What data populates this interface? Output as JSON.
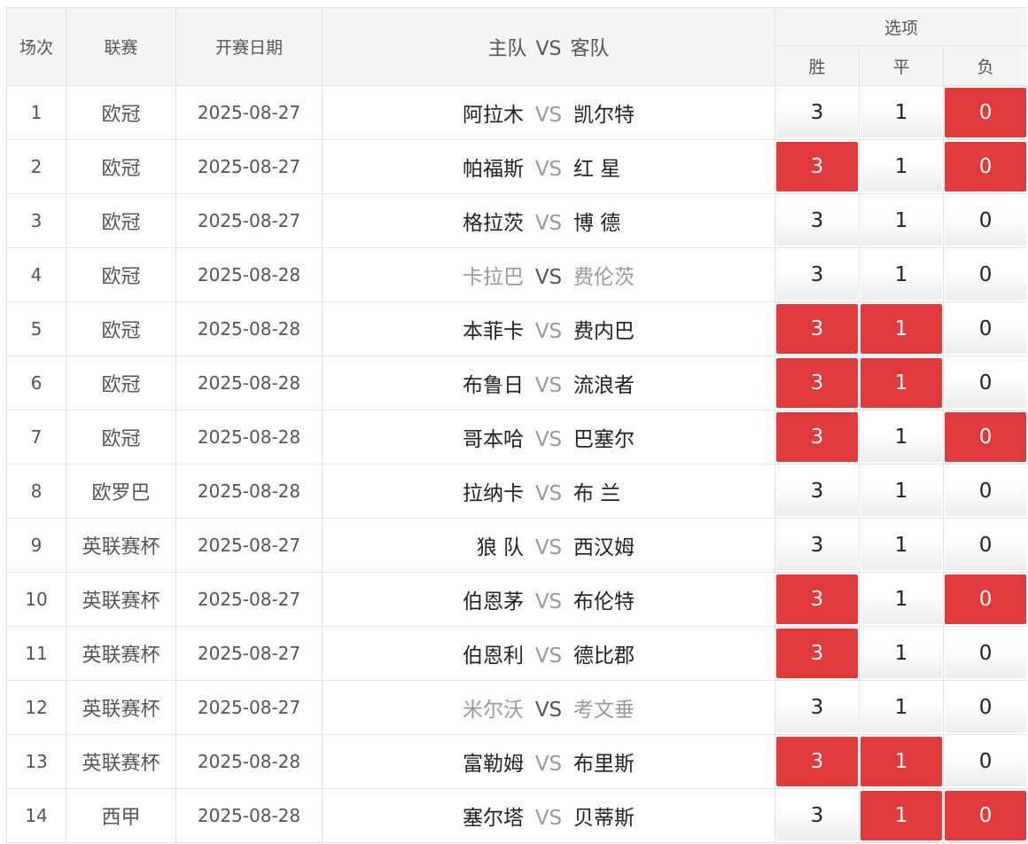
{
  "header": {
    "round": "场次",
    "league": "联赛",
    "date": "开赛日期",
    "home": "主队",
    "vs": "VS",
    "away": "客队",
    "options": "选项",
    "win": "胜",
    "draw": "平",
    "lose": "负"
  },
  "accent_color": "#e03a3c",
  "rows": [
    {
      "n": "1",
      "league": "欧冠",
      "date": "2025-08-27",
      "home": "阿拉木",
      "away": "凯尔特",
      "dim": false,
      "w": "3",
      "d": "1",
      "l": "0",
      "ws": false,
      "ds": false,
      "ls": true
    },
    {
      "n": "2",
      "league": "欧冠",
      "date": "2025-08-27",
      "home": "帕福斯",
      "away": "红 星",
      "dim": false,
      "w": "3",
      "d": "1",
      "l": "0",
      "ws": true,
      "ds": false,
      "ls": true
    },
    {
      "n": "3",
      "league": "欧冠",
      "date": "2025-08-27",
      "home": "格拉茨",
      "away": "博 德",
      "dim": false,
      "w": "3",
      "d": "1",
      "l": "0",
      "ws": false,
      "ds": false,
      "ls": false
    },
    {
      "n": "4",
      "league": "欧冠",
      "date": "2025-08-28",
      "home": "卡拉巴",
      "away": "费伦茨",
      "dim": true,
      "w": "3",
      "d": "1",
      "l": "0",
      "ws": false,
      "ds": false,
      "ls": false
    },
    {
      "n": "5",
      "league": "欧冠",
      "date": "2025-08-28",
      "home": "本菲卡",
      "away": "费内巴",
      "dim": false,
      "w": "3",
      "d": "1",
      "l": "0",
      "ws": true,
      "ds": true,
      "ls": false
    },
    {
      "n": "6",
      "league": "欧冠",
      "date": "2025-08-28",
      "home": "布鲁日",
      "away": "流浪者",
      "dim": false,
      "w": "3",
      "d": "1",
      "l": "0",
      "ws": true,
      "ds": true,
      "ls": false
    },
    {
      "n": "7",
      "league": "欧冠",
      "date": "2025-08-28",
      "home": "哥本哈",
      "away": "巴塞尔",
      "dim": false,
      "w": "3",
      "d": "1",
      "l": "0",
      "ws": true,
      "ds": false,
      "ls": true
    },
    {
      "n": "8",
      "league": "欧罗巴",
      "date": "2025-08-28",
      "home": "拉纳卡",
      "away": "布 兰",
      "dim": false,
      "w": "3",
      "d": "1",
      "l": "0",
      "ws": false,
      "ds": false,
      "ls": false
    },
    {
      "n": "9",
      "league": "英联赛杯",
      "date": "2025-08-27",
      "home": "狼 队",
      "away": "西汉姆",
      "dim": false,
      "w": "3",
      "d": "1",
      "l": "0",
      "ws": false,
      "ds": false,
      "ls": false
    },
    {
      "n": "10",
      "league": "英联赛杯",
      "date": "2025-08-27",
      "home": "伯恩茅",
      "away": "布伦特",
      "dim": false,
      "w": "3",
      "d": "1",
      "l": "0",
      "ws": true,
      "ds": false,
      "ls": true
    },
    {
      "n": "11",
      "league": "英联赛杯",
      "date": "2025-08-27",
      "home": "伯恩利",
      "away": "德比郡",
      "dim": false,
      "w": "3",
      "d": "1",
      "l": "0",
      "ws": true,
      "ds": false,
      "ls": false
    },
    {
      "n": "12",
      "league": "英联赛杯",
      "date": "2025-08-27",
      "home": "米尔沃",
      "away": "考文垂",
      "dim": true,
      "w": "3",
      "d": "1",
      "l": "0",
      "ws": false,
      "ds": false,
      "ls": false
    },
    {
      "n": "13",
      "league": "英联赛杯",
      "date": "2025-08-28",
      "home": "富勒姆",
      "away": "布里斯",
      "dim": false,
      "w": "3",
      "d": "1",
      "l": "0",
      "ws": true,
      "ds": true,
      "ls": false
    },
    {
      "n": "14",
      "league": "西甲",
      "date": "2025-08-28",
      "home": "塞尔塔",
      "away": "贝蒂斯",
      "dim": false,
      "w": "3",
      "d": "1",
      "l": "0",
      "ws": false,
      "ds": true,
      "ls": true
    }
  ]
}
